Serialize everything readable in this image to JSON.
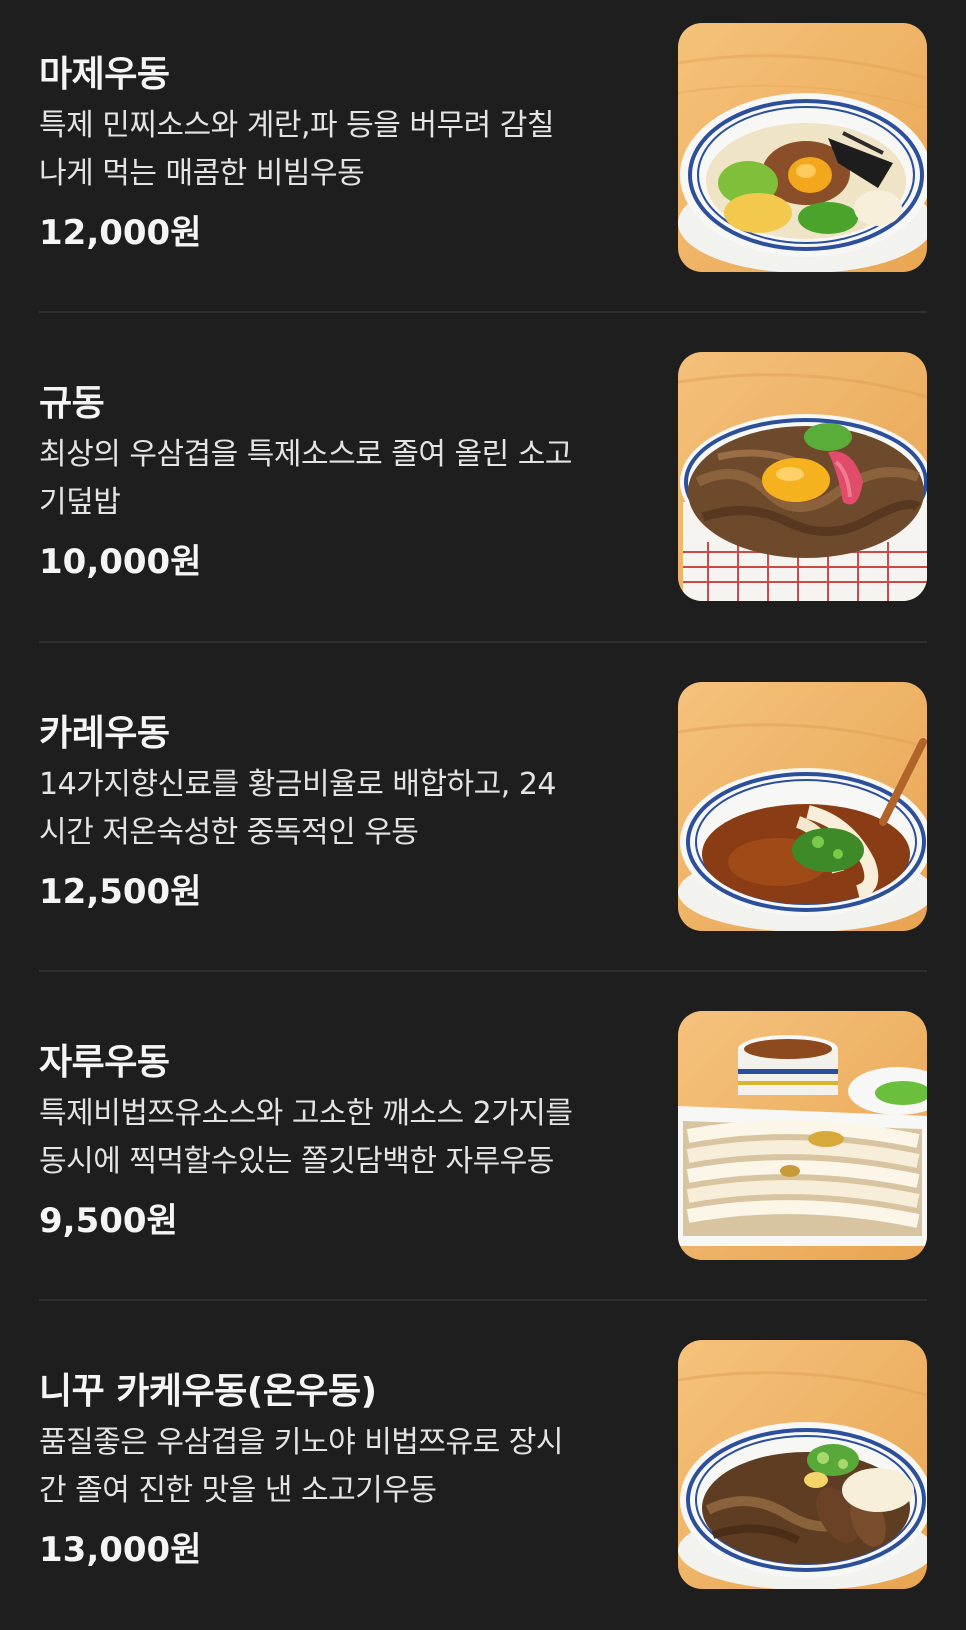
{
  "menu": {
    "items": [
      {
        "name": "마제우동",
        "desc_line1": "특제 민찌소스와 계란,파 등을 버무려 감칠",
        "desc_line2": "나게 먹는 매콤한 비빔우동",
        "price": "12,000원",
        "image_icon": "bibim-udon-photo"
      },
      {
        "name": "규동",
        "desc_line1": "최상의 우삼겹을 특제소스로 졸여 올린 소고",
        "desc_line2": "기덮밥",
        "price": "10,000원",
        "image_icon": "gyudon-photo"
      },
      {
        "name": "카레우동",
        "desc_line1": "14가지향신료를 황금비율로 배합하고, 24",
        "desc_line2": "시간 저온숙성한 중독적인 우동",
        "price": "12,500원",
        "image_icon": "curry-udon-photo"
      },
      {
        "name": "자루우동",
        "desc_line1": "특제비법쯔유소스와 고소한 깨소스 2가지를",
        "desc_line2": "동시에 찍먹할수있는 쫄깃담백한 자루우동",
        "price": "9,500원",
        "image_icon": "zaru-udon-photo"
      },
      {
        "name": "니꾸 카케우동(온우동)",
        "desc_line1": "품질좋은 우삼겹을 키노야 비법쯔유로 장시",
        "desc_line2": "간 졸여 진한 맛을 낸 소고기우동",
        "price": "13,000원",
        "image_icon": "niku-udon-photo"
      }
    ]
  },
  "colors": {
    "background": "#1e1e1e",
    "divider": "#2e2e2e",
    "text_primary": "#f5f5f5",
    "text_secondary": "#e4e4e4",
    "photo_table_wood": "#f0b96a",
    "bowl_white": "#f7f7f5",
    "bowl_rim_blue": "#2c4f9c"
  }
}
